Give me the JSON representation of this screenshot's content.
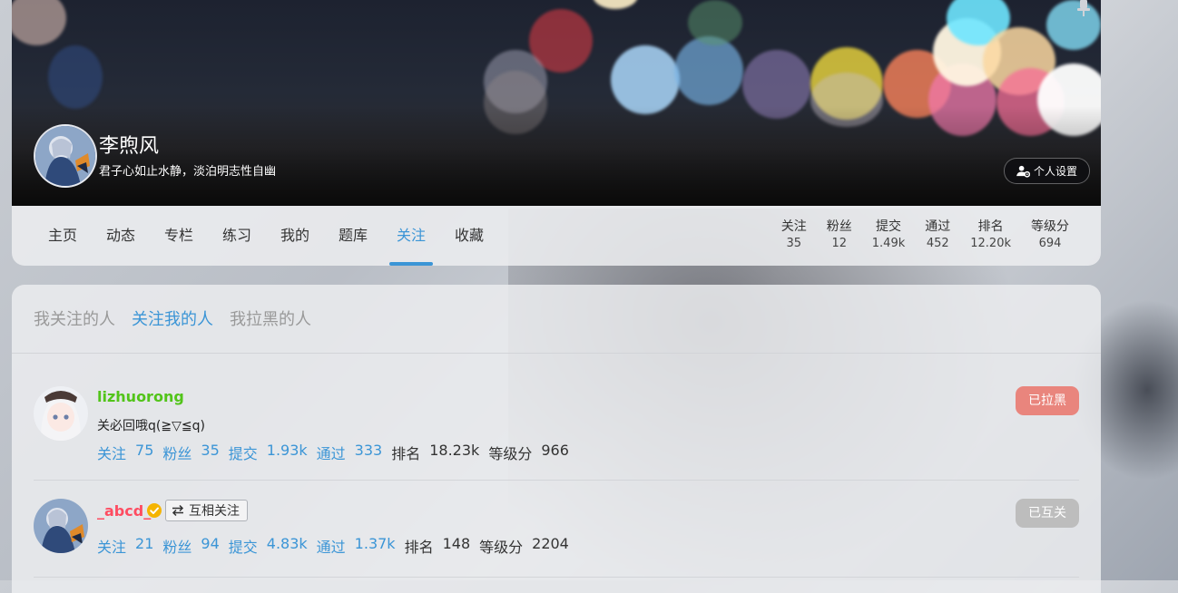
{
  "profile": {
    "name": "李煦风",
    "bio": "君子心如止水静，淡泊明志性自幽",
    "settings_label": "个人设置"
  },
  "nav": {
    "tabs": [
      "主页",
      "动态",
      "专栏",
      "练习",
      "我的",
      "题库",
      "关注",
      "收藏"
    ],
    "active_tab": "关注",
    "stats": [
      {
        "label": "关注",
        "value": "35"
      },
      {
        "label": "粉丝",
        "value": "12"
      },
      {
        "label": "提交",
        "value": "1.49k"
      },
      {
        "label": "通过",
        "value": "452"
      },
      {
        "label": "排名",
        "value": "12.20k"
      },
      {
        "label": "等级分",
        "value": "694"
      }
    ]
  },
  "follow": {
    "subtabs": [
      "我关注的人",
      "关注我的人",
      "我拉黑的人"
    ],
    "active_subtab": "关注我的人",
    "users": [
      {
        "name": "lizhuorong",
        "bio": "关必回哦q(≧▽≦q)",
        "stats": {
          "关注": "75",
          "粉丝": "35",
          "提交": "1.93k",
          "通过": "333",
          "排名": "18.23k",
          "等级分": "966"
        },
        "state": "已拉黑"
      },
      {
        "name": "_abcd_",
        "badge": "互相关注",
        "verified": true,
        "stats": {
          "关注": "21",
          "粉丝": "94",
          "提交": "4.83k",
          "通过": "1.37k",
          "排名": "148",
          "等级分": "2204"
        },
        "state": "已互关"
      }
    ]
  },
  "colors": {
    "accent": "#3b95d6",
    "name_green": "#52c41a",
    "name_red": "#fe4c61",
    "blocked_button": "#e9857d",
    "mutual_button": "#bdbdbd"
  },
  "icons": {
    "settings": "user-gear-icon",
    "verified": "verified-check-icon",
    "mutual": "swap-arrows-icon",
    "pin": "pin-icon"
  }
}
